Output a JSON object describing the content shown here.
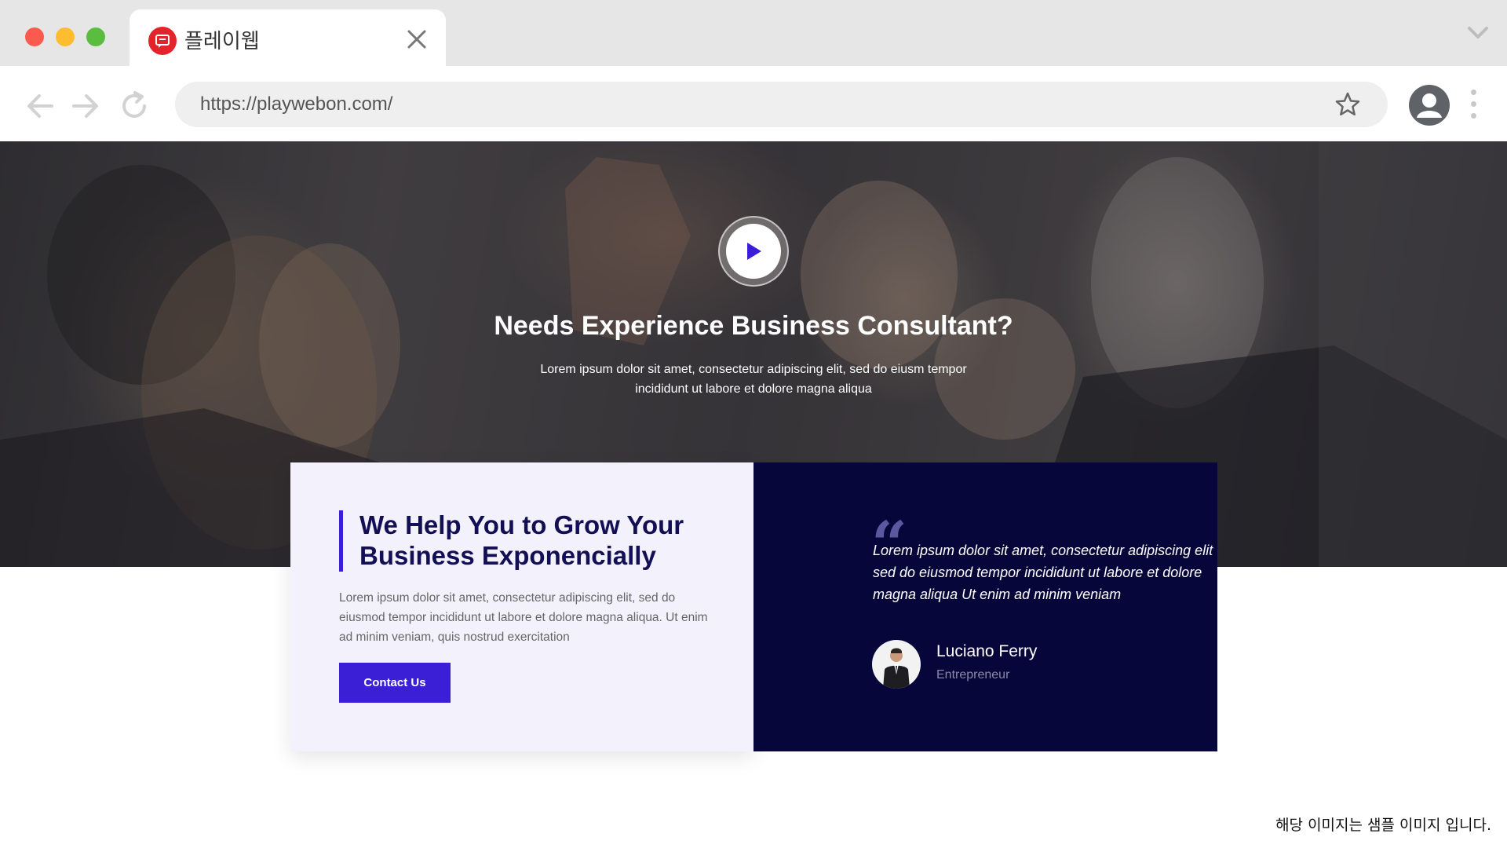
{
  "browser": {
    "tab_title": "플레이웹",
    "url": "https://playwebon.com/"
  },
  "hero": {
    "title": "Needs Experience Business Consultant?",
    "subtitle": "Lorem ipsum dolor sit amet, consectetur adipiscing elit, sed do eiusm tempor incididunt ut labore et dolore magna aliqua"
  },
  "feature": {
    "heading": "We Help You to Grow Your Business Exponencially",
    "text": "Lorem ipsum dolor sit amet, consectetur adipiscing elit, sed do eiusmod tempor incididunt ut labore et dolore magna aliqua. Ut enim ad minim veniam, quis nostrud exercitation",
    "button_label": "Contact Us"
  },
  "testimonial": {
    "quote_lines": [
      "Lorem ipsum dolor sit amet, consectetur adipiscing elit",
      "sed do eiusmod tempor incididunt ut labore et dolore",
      "magna aliqua Ut enim ad minim veniam"
    ],
    "author_name": "Luciano Ferry",
    "author_role": "Entrepreneur"
  },
  "footer_note": "해당 이미지는 샘플 이미지 입니다.",
  "colors": {
    "accent": "#3a1fd6",
    "navy": "#07063a",
    "heading": "#130f55"
  }
}
